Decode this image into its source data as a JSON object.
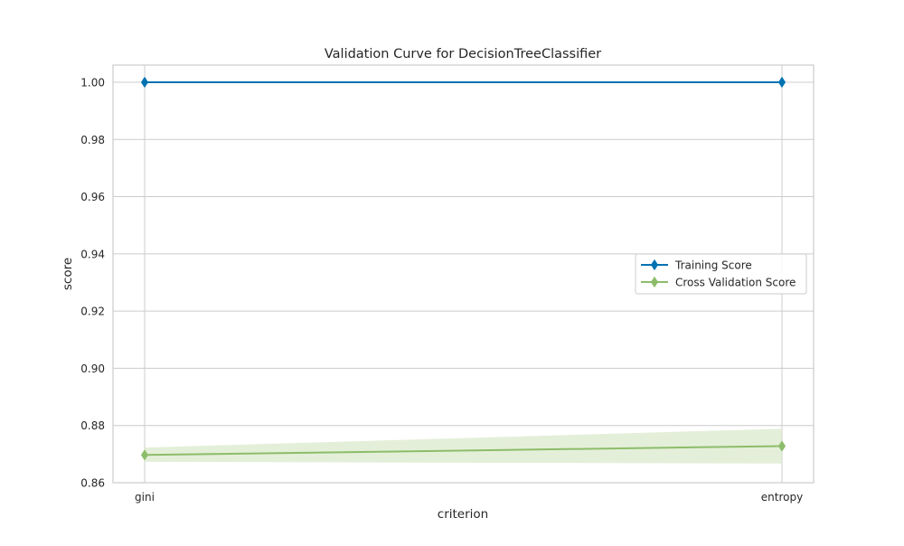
{
  "chart_data": {
    "type": "line",
    "title": "Validation Curve for DecisionTreeClassifier",
    "xlabel": "criterion",
    "ylabel": "score",
    "categories": [
      "gini",
      "entropy"
    ],
    "ylim": [
      0.86,
      1.006
    ],
    "yticks": [
      0.86,
      0.88,
      0.9,
      0.92,
      0.94,
      0.96,
      0.98,
      1.0
    ],
    "ytick_labels": [
      "0.86",
      "0.88",
      "0.90",
      "0.92",
      "0.94",
      "0.96",
      "0.98",
      "1.00"
    ],
    "grid": true,
    "legend_position": "center-right",
    "series": [
      {
        "name": "Training Score",
        "values": [
          1.0,
          1.0
        ],
        "band_lower": [
          1.0,
          1.0
        ],
        "band_upper": [
          1.0,
          1.0
        ],
        "color": "#0072b2",
        "band_color": "#0072b2",
        "marker": "diamond"
      },
      {
        "name": "Cross Validation Score",
        "values": [
          0.8697,
          0.8728
        ],
        "band_lower": [
          0.8673,
          0.8667
        ],
        "band_upper": [
          0.8723,
          0.8789
        ],
        "color": "#8cbd6a",
        "band_color": "#dbe9cc",
        "marker": "diamond"
      }
    ]
  }
}
